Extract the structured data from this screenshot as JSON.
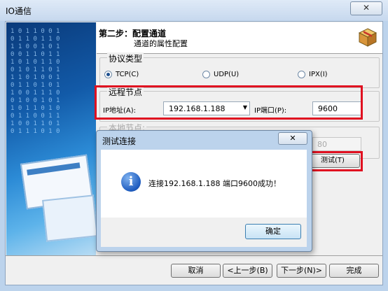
{
  "window": {
    "title": "IO通信",
    "close_label": "✕"
  },
  "header": {
    "step_title": "第二步：配置通道",
    "step_subtitle": "通道的属性配置"
  },
  "protocol": {
    "group_label": "协议类型",
    "options": [
      {
        "label": "TCP(C)",
        "selected": true
      },
      {
        "label": "UDP(U)",
        "selected": false
      },
      {
        "label": "IPX(I)",
        "selected": false
      }
    ]
  },
  "remote": {
    "group_label": "远程节点",
    "ip_label": "IP地址(A):",
    "ip_value": "192.168.1.188",
    "port_label": "IP端口(P):",
    "port_value": "9600"
  },
  "local": {
    "group_label": "本地节点:",
    "port_value": "80"
  },
  "test_button": "测试(T)",
  "footer": {
    "cancel": "取消",
    "prev": "<上一步(B)",
    "next": "下一步(N)>",
    "finish": "完成"
  },
  "dialog": {
    "title": "测试连接",
    "close_label": "✕",
    "message": "连接192.168.1.188  端口9600成功！",
    "ok": "确定"
  },
  "colors": {
    "highlight": "#e01020",
    "accent": "#1e5cbf"
  }
}
